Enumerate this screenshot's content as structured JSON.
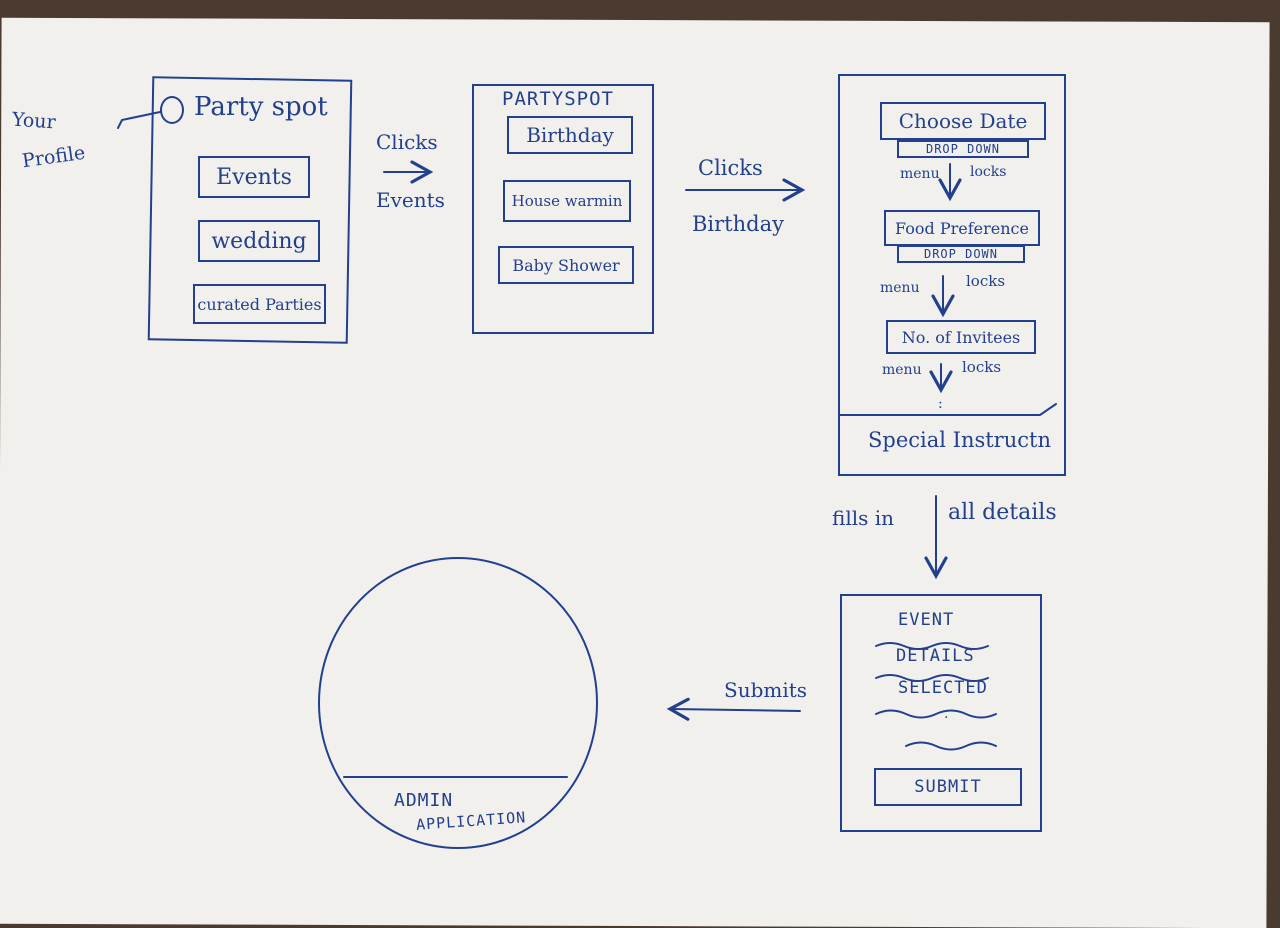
{
  "ink_color": "#23408e",
  "paper_color": "#f1f0ec",
  "screen1": {
    "profile_label_line1": "Your",
    "profile_label_line2": "Profile",
    "profile_icon": "circle-profile-icon",
    "title": "Party spot",
    "buttons": [
      "Events",
      "wedding",
      "curated Parties"
    ]
  },
  "arrow1": {
    "label_top": "Clicks",
    "label_bottom": "Events"
  },
  "screen2": {
    "title": "PARTYSPOT",
    "buttons": [
      "Birthday",
      "House warmin",
      "Baby Shower"
    ]
  },
  "arrow2": {
    "label_top": "Clicks",
    "label_bottom": "Birthday"
  },
  "screen3": {
    "field1": {
      "label": "Choose Date",
      "control": "DROP DOWN",
      "note_left": "menu",
      "note_right": "locks"
    },
    "field2": {
      "label": "Food Preference",
      "control": "DROP DOWN",
      "note_left": "menu",
      "note_right": "locks"
    },
    "field3": {
      "label": "No. of Invitees",
      "note_left": "menu",
      "note_right": "locks"
    },
    "ellipsis": ":",
    "footer": "Special Instructn"
  },
  "arrow3": {
    "label_left": "fills in",
    "label_right": "all details"
  },
  "screen4": {
    "lines": [
      "EVENT",
      "DETAILS",
      "SELECTED"
    ],
    "dot": ".",
    "submit": "SUBMIT"
  },
  "arrow4": {
    "label": "Submits"
  },
  "admin": {
    "line1": "ADMIN",
    "line2": "APPLICATION"
  }
}
